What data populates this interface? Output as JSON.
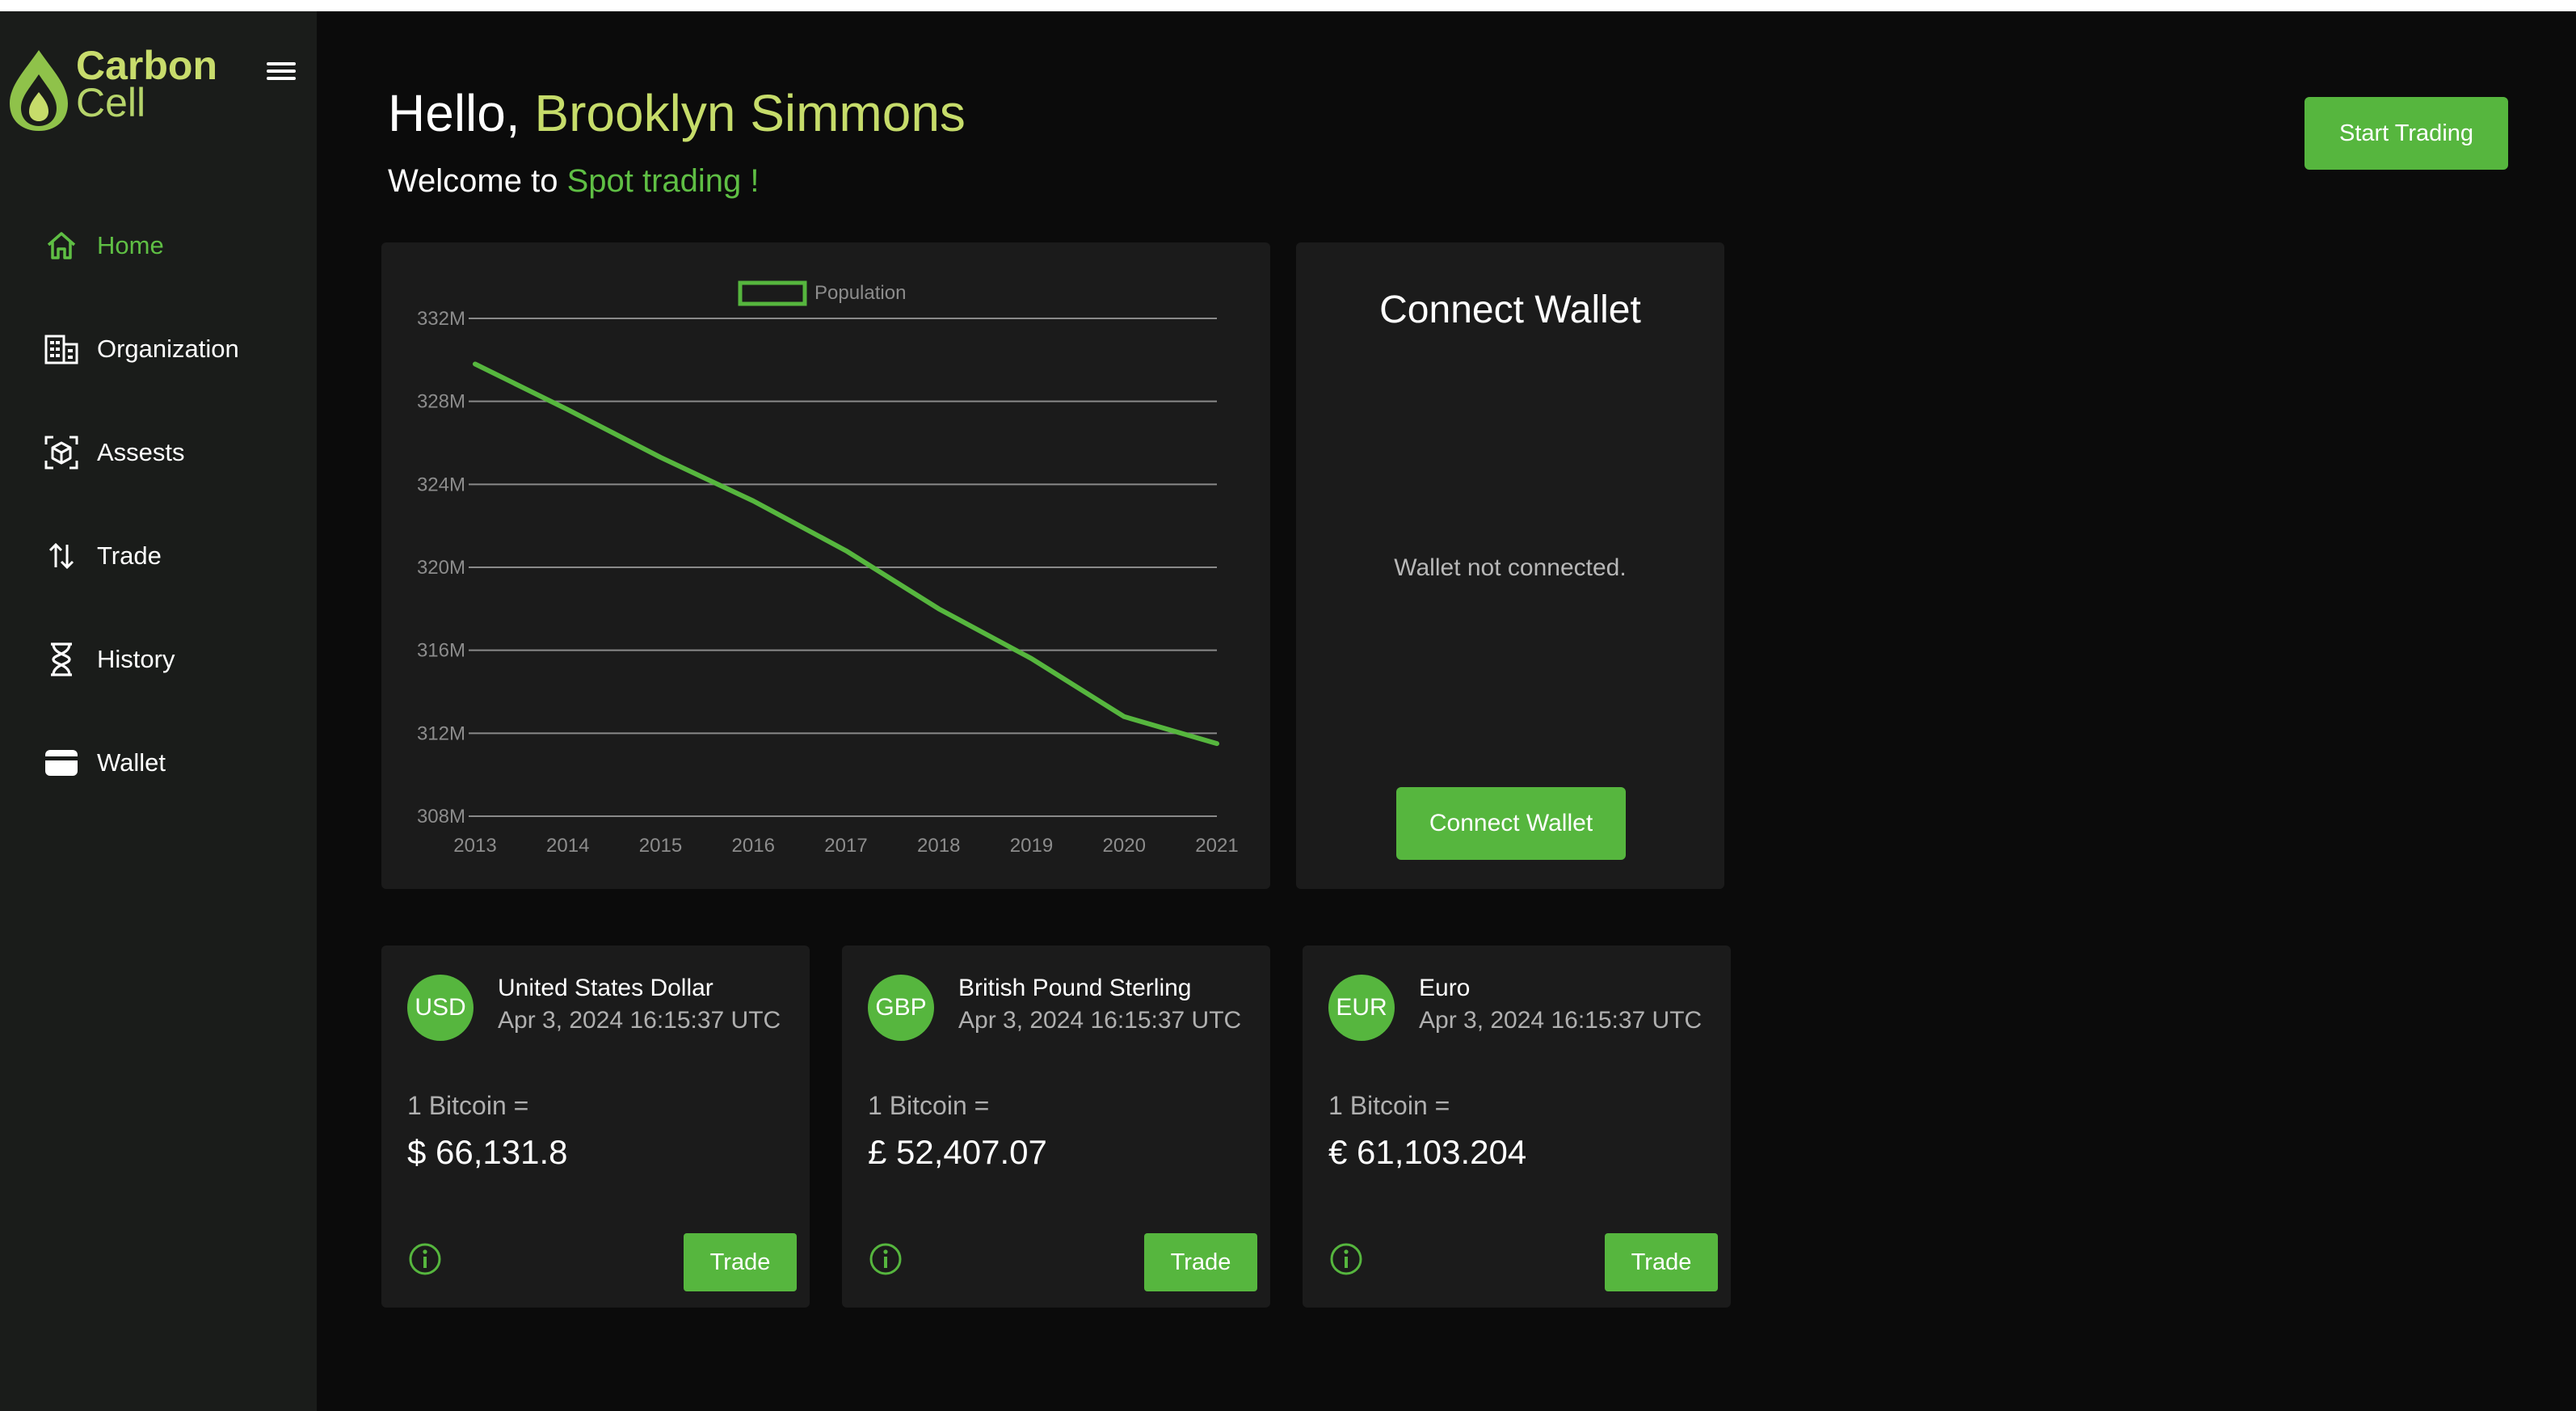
{
  "app": {
    "logo_line1": "Carbon",
    "logo_line2": "Cell",
    "accent_color": "#56b63e",
    "name_color": "#c6dc6a"
  },
  "sidebar": {
    "items": [
      {
        "label": "Home",
        "icon": "home-icon",
        "active": true
      },
      {
        "label": "Organization",
        "icon": "building-icon",
        "active": false
      },
      {
        "label": "Assests",
        "icon": "cube-scan-icon",
        "active": false
      },
      {
        "label": "Trade",
        "icon": "arrows-updown-icon",
        "active": false
      },
      {
        "label": "History",
        "icon": "hourglass-icon",
        "active": false
      },
      {
        "label": "Wallet",
        "icon": "wallet-icon",
        "active": false
      }
    ]
  },
  "header": {
    "greeting": "Hello,",
    "user_name": "Brooklyn Simmons",
    "welcome_prefix": "Welcome to",
    "welcome_accent": "Spot trading !",
    "start_trading": "Start Trading"
  },
  "chart_data": {
    "type": "line",
    "x": [
      2013,
      2014,
      2015,
      2016,
      2017,
      2018,
      2019,
      2020,
      2021
    ],
    "series": [
      {
        "name": "Population",
        "values": [
          329.8,
          327.6,
          325.3,
          323.2,
          320.8,
          318.0,
          315.6,
          312.8,
          311.5
        ]
      }
    ],
    "ylim": [
      308,
      332
    ],
    "yticks": [
      "308M",
      "312M",
      "316M",
      "320M",
      "324M",
      "328M",
      "332M"
    ],
    "ytick_values": [
      308,
      312,
      316,
      320,
      324,
      328,
      332
    ],
    "xticks": [
      "2013",
      "2014",
      "2015",
      "2016",
      "2017",
      "2018",
      "2019",
      "2020",
      "2021"
    ],
    "legend": "top-center",
    "grid": true,
    "line_color": "#56b63e"
  },
  "wallet": {
    "title": "Connect Wallet",
    "status": "Wallet not connected.",
    "button": "Connect Wallet"
  },
  "currencies": [
    {
      "code": "USD",
      "name": "United States Dollar",
      "time": "Apr 3, 2024 16:15:37 UTC",
      "btc_label": "1 Bitcoin =",
      "value": "$ 66,131.8",
      "button": "Trade"
    },
    {
      "code": "GBP",
      "name": "British Pound Sterling",
      "time": "Apr 3, 2024 16:15:37 UTC",
      "btc_label": "1 Bitcoin =",
      "value": "£ 52,407.07",
      "button": "Trade"
    },
    {
      "code": "EUR",
      "name": "Euro",
      "time": "Apr 3, 2024 16:15:37 UTC",
      "btc_label": "1 Bitcoin =",
      "value": "€ 61,103.204",
      "button": "Trade"
    }
  ]
}
